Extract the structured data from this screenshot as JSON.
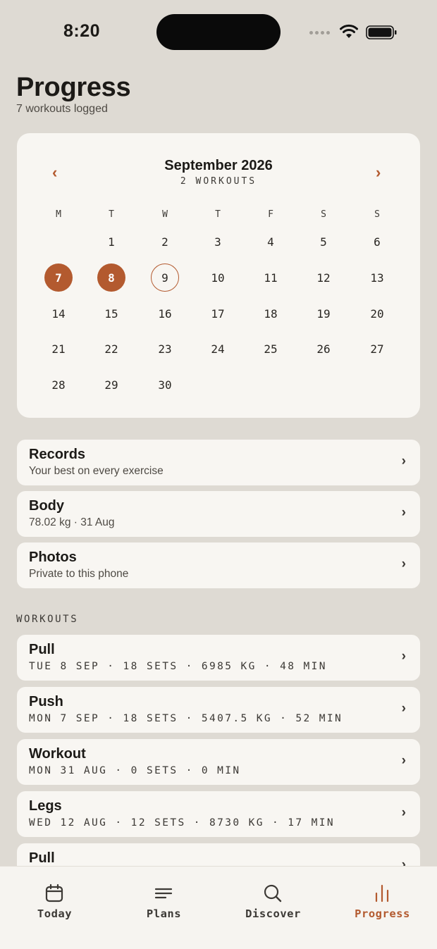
{
  "status_bar": {
    "time": "8:20"
  },
  "header": {
    "title": "Progress",
    "subtitle": "7 workouts logged"
  },
  "calendar": {
    "prev_icon": "chevron-left-icon",
    "next_icon": "chevron-right-icon",
    "month": "September 2026",
    "count": "2 WORKOUTS",
    "weekdays": [
      "M",
      "T",
      "W",
      "T",
      "F",
      "S",
      "S"
    ],
    "days": [
      "1",
      "2",
      "3",
      "4",
      "5",
      "6",
      "7",
      "8",
      "9",
      "10",
      "11",
      "12",
      "13",
      "14",
      "15",
      "16",
      "17",
      "18",
      "19",
      "20",
      "21",
      "22",
      "23",
      "24",
      "25",
      "26",
      "27",
      "28",
      "29",
      "30"
    ],
    "workout_days": [
      "7",
      "8"
    ],
    "today": "9",
    "accent": "#b35a2f"
  },
  "nav_rows": [
    {
      "title": "Records",
      "subtitle": "Your best on every exercise"
    },
    {
      "title": "Body",
      "subtitle": "78.02 kg · 31 Aug"
    },
    {
      "title": "Photos",
      "subtitle": "Private to this phone"
    }
  ],
  "workouts": {
    "label": "WORKOUTS",
    "items": [
      {
        "title": "Pull",
        "meta": "TUE 8 SEP · 18 SETS · 6985 KG · 48 MIN"
      },
      {
        "title": "Push",
        "meta": "MON 7 SEP · 18 SETS · 5407.5 KG · 52 MIN"
      },
      {
        "title": "Workout",
        "meta": "MON 31 AUG · 0 SETS · 0 MIN"
      },
      {
        "title": "Legs",
        "meta": "WED 12 AUG · 12 SETS · 8730 KG · 17 MIN"
      },
      {
        "title": "Pull",
        "meta": ""
      }
    ]
  },
  "tabbar": {
    "tabs": [
      {
        "label": "Today",
        "icon": "calendar-icon"
      },
      {
        "label": "Plans",
        "icon": "list-icon"
      },
      {
        "label": "Discover",
        "icon": "search-icon"
      },
      {
        "label": "Progress",
        "icon": "bar-chart-icon"
      }
    ],
    "active": "Progress"
  }
}
